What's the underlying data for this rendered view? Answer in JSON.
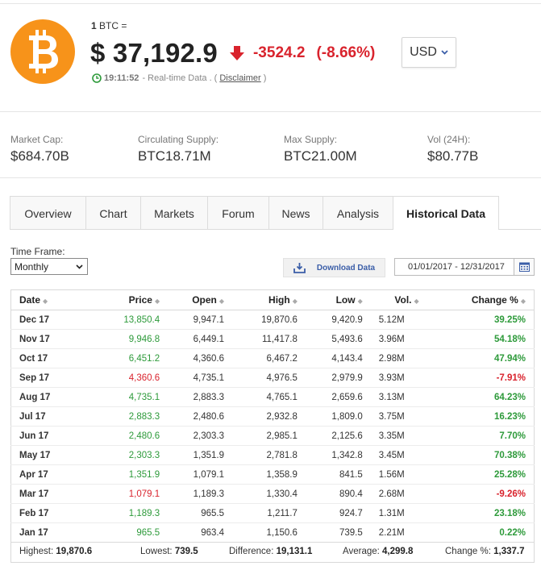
{
  "header": {
    "unit_prefix": "1",
    "unit_suffix": "BTC =",
    "price": "$ 37,192.9",
    "change": "-3524.2",
    "change_pct": "(-8.66%)",
    "currency": "USD",
    "time": "19:11:52",
    "realtime_text": "- Real-time Data . (",
    "disclaimer": "Disclaimer",
    "realtime_close": ")",
    "colors": {
      "logo": "#f7931a",
      "negative": "#d9232d",
      "positive": "#2d9a3a",
      "link_blue": "#3b5ea8"
    }
  },
  "stats": [
    {
      "label": "Market Cap:",
      "value": "$684.70B"
    },
    {
      "label": "Circulating Supply:",
      "value": "BTC18.71M"
    },
    {
      "label": "Max Supply:",
      "value": "BTC21.00M"
    },
    {
      "label": "Vol (24H):",
      "value": "$80.77B"
    }
  ],
  "tabs": [
    "Overview",
    "Chart",
    "Markets",
    "Forum",
    "News",
    "Analysis",
    "Historical Data"
  ],
  "active_tab": "Historical Data",
  "controls": {
    "timeframe_label": "Time Frame:",
    "timeframe_value": "Monthly",
    "download_label": "Download Data",
    "date_range": "01/01/2017 - 12/31/2017"
  },
  "table": {
    "columns": [
      "Date",
      "Price",
      "Open",
      "High",
      "Low",
      "Vol.",
      "Change %"
    ],
    "rows": [
      {
        "date": "Dec 17",
        "price": "13,850.4",
        "open": "9,947.1",
        "high": "19,870.6",
        "low": "9,420.9",
        "vol": "5.12M",
        "change": "39.25%",
        "dir": "up"
      },
      {
        "date": "Nov 17",
        "price": "9,946.8",
        "open": "6,449.1",
        "high": "11,417.8",
        "low": "5,493.6",
        "vol": "3.96M",
        "change": "54.18%",
        "dir": "up"
      },
      {
        "date": "Oct 17",
        "price": "6,451.2",
        "open": "4,360.6",
        "high": "6,467.2",
        "low": "4,143.4",
        "vol": "2.98M",
        "change": "47.94%",
        "dir": "up"
      },
      {
        "date": "Sep 17",
        "price": "4,360.6",
        "open": "4,735.1",
        "high": "4,976.5",
        "low": "2,979.9",
        "vol": "3.93M",
        "change": "-7.91%",
        "dir": "down"
      },
      {
        "date": "Aug 17",
        "price": "4,735.1",
        "open": "2,883.3",
        "high": "4,765.1",
        "low": "2,659.6",
        "vol": "3.13M",
        "change": "64.23%",
        "dir": "up"
      },
      {
        "date": "Jul 17",
        "price": "2,883.3",
        "open": "2,480.6",
        "high": "2,932.8",
        "low": "1,809.0",
        "vol": "3.75M",
        "change": "16.23%",
        "dir": "up"
      },
      {
        "date": "Jun 17",
        "price": "2,480.6",
        "open": "2,303.3",
        "high": "2,985.1",
        "low": "2,125.6",
        "vol": "3.35M",
        "change": "7.70%",
        "dir": "up"
      },
      {
        "date": "May 17",
        "price": "2,303.3",
        "open": "1,351.9",
        "high": "2,781.8",
        "low": "1,342.8",
        "vol": "3.45M",
        "change": "70.38%",
        "dir": "up"
      },
      {
        "date": "Apr 17",
        "price": "1,351.9",
        "open": "1,079.1",
        "high": "1,358.9",
        "low": "841.5",
        "vol": "1.56M",
        "change": "25.28%",
        "dir": "up"
      },
      {
        "date": "Mar 17",
        "price": "1,079.1",
        "open": "1,189.3",
        "high": "1,330.4",
        "low": "890.4",
        "vol": "2.68M",
        "change": "-9.26%",
        "dir": "down"
      },
      {
        "date": "Feb 17",
        "price": "1,189.3",
        "open": "965.5",
        "high": "1,211.7",
        "low": "924.7",
        "vol": "1.31M",
        "change": "23.18%",
        "dir": "up"
      },
      {
        "date": "Jan 17",
        "price": "965.5",
        "open": "963.4",
        "high": "1,150.6",
        "low": "739.5",
        "vol": "2.21M",
        "change": "0.22%",
        "dir": "up"
      }
    ]
  },
  "summary": [
    {
      "label": "Highest:",
      "value": "19,870.6"
    },
    {
      "label": "Lowest:",
      "value": "739.5"
    },
    {
      "label": "Difference:",
      "value": "19,131.1"
    },
    {
      "label": "Average:",
      "value": "4,299.8"
    },
    {
      "label": "Change %:",
      "value": "1,337.7"
    }
  ]
}
